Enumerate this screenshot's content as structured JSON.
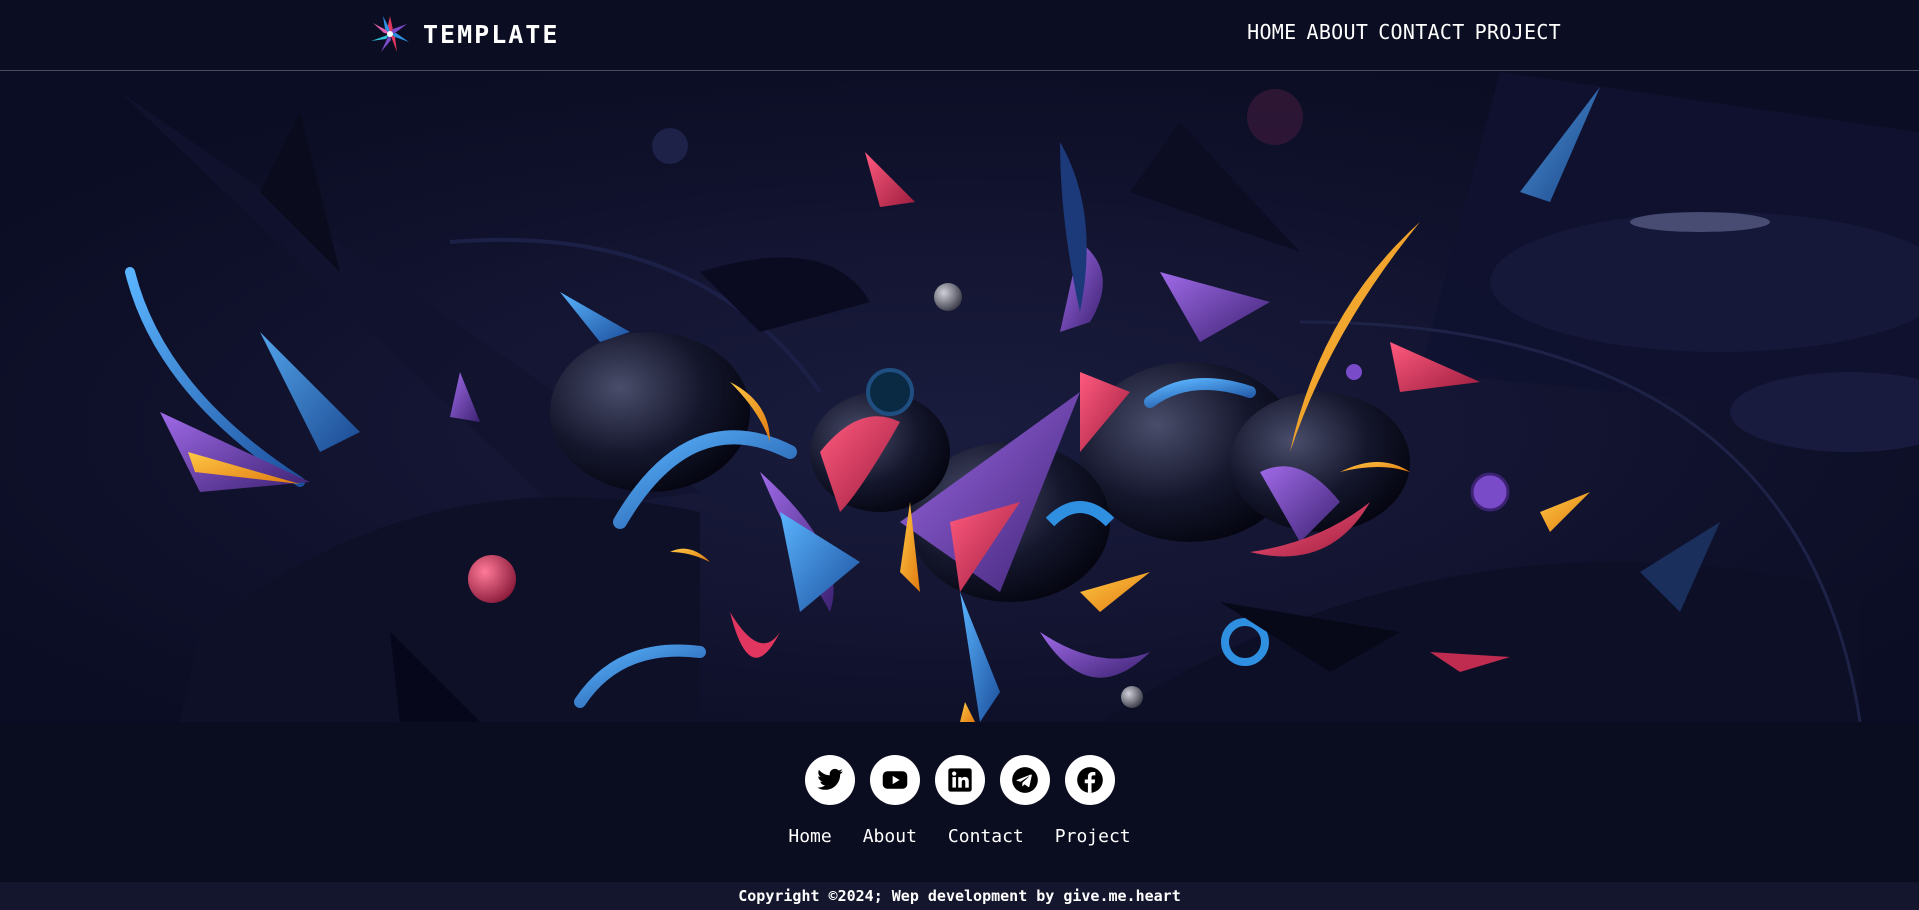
{
  "brand": {
    "name": "TEMPLATE",
    "logo_icon": "star-burst-logo-icon"
  },
  "nav": {
    "items": [
      {
        "label": "HOME"
      },
      {
        "label": "ABOUT"
      },
      {
        "label": "CONTACT"
      },
      {
        "label": "PROJECT"
      }
    ]
  },
  "hero": {
    "image": "abstract-3d-shapes-hero-image"
  },
  "footer": {
    "socials": [
      {
        "icon": "twitter-icon"
      },
      {
        "icon": "youtube-icon"
      },
      {
        "icon": "linkedin-icon"
      },
      {
        "icon": "telegram-icon"
      },
      {
        "icon": "facebook-icon"
      }
    ],
    "links": [
      {
        "label": "Home"
      },
      {
        "label": "About"
      },
      {
        "label": "Contact"
      },
      {
        "label": "Project"
      }
    ],
    "copyright": "Copyright ©2024; Wep development by give.me.heart"
  },
  "colors": {
    "background": "#0a0c1f",
    "header_border": "#4a4d63",
    "copyright_bar": "#13162c",
    "accent_pink": "#e0365f",
    "accent_blue": "#2f8fe0",
    "accent_purple": "#7a4bc9",
    "accent_orange": "#f5a623"
  }
}
